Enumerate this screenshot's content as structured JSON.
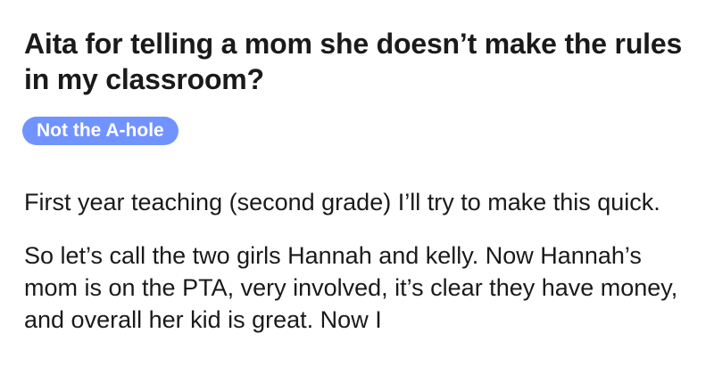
{
  "post": {
    "title": "Aita for telling a mom she doesn’t make the rules in my classroom?",
    "flair": "Not the A-hole",
    "flair_color": "#7193ff",
    "paragraphs": [
      "First year teaching (second grade) I’ll try to make this quick.",
      "So let’s call the two girls Hannah and kelly. Now Hannah’s mom is on the PTA, very involved, it’s clear they have money, and overall her kid is great. Now I"
    ]
  }
}
